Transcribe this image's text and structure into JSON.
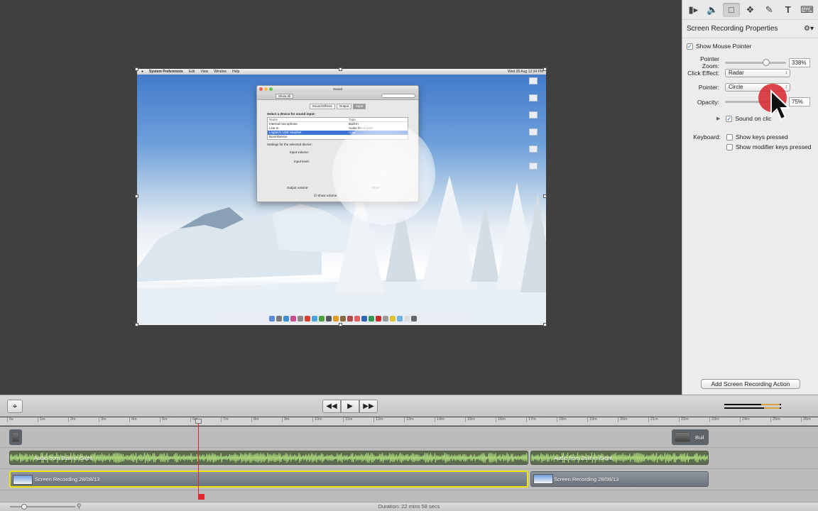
{
  "preview": {
    "menubar": {
      "app": "System Preferences",
      "items": [
        "Edit",
        "View",
        "Window",
        "Help"
      ],
      "clock": "Wed 28 Aug 12:34 PM"
    },
    "sound_window": {
      "title": "Sound",
      "show_all": "Show All",
      "tabs": [
        "Sound Effects",
        "Output",
        "Input"
      ],
      "select_label": "Select a device for sound input:",
      "columns": [
        "Name",
        "Type"
      ],
      "devices": [
        {
          "name": "Internal microphone",
          "type": "Built-in"
        },
        {
          "name": "Line In",
          "type": "Audio line-in port"
        },
        {
          "name": "Logitech USB Headset",
          "type": "USB"
        },
        {
          "name": "BoomDevice",
          "type": ""
        }
      ],
      "settings_label": "Settings for the selected device:",
      "input_volume": "Input volume:",
      "input_level": "Input level:",
      "output_volume": "Output volume:",
      "mute": "Mute",
      "show_volume": "Show volume"
    }
  },
  "panel": {
    "header": "Screen Recording Properties",
    "show_mouse_pointer": "Show Mouse Pointer",
    "pointer_zoom_label": "Pointer Zoom:",
    "pointer_zoom_value": "338%",
    "pointer_zoom_fraction": 0.67,
    "click_effect_label": "Click Effect:",
    "click_effect_value": "Radar",
    "pointer_label": "Pointer:",
    "pointer_value": "Circle",
    "opacity_label": "Opacity:",
    "opacity_value": "75%",
    "sound_on_click": "Sound on clic",
    "keyboard_label": "Keyboard:",
    "show_keys": "Show keys pressed",
    "show_modifier_keys": "Show modifier keys pressed",
    "add_action": "Add Screen Recording Action",
    "accent_color": "#1a5fc1"
  },
  "timeline": {
    "ruler_ticks": [
      "0s",
      "1m",
      "2m",
      "3m",
      "4m",
      "5m",
      "6m",
      "7m",
      "8m",
      "9m",
      "10m",
      "11m",
      "12m",
      "13m",
      "14m",
      "15m",
      "16m",
      "17m",
      "18m",
      "19m",
      "20m",
      "21m",
      "22m",
      "23m",
      "24m",
      "25m",
      "26m"
    ],
    "audio_clip_1": "Audio from Built-in iSight",
    "audio_clip_2": "Audio from Built-in iSight",
    "video_clip_1": "Screen Recording 28/08/13",
    "video_clip_2": "Screen Recording 28/08/13",
    "camera_clip": "Buil",
    "selected_clip_color": "#f1e400",
    "playhead_color": "#e0262c"
  },
  "status": {
    "duration": "Duration: 22 mins 58 secs"
  }
}
